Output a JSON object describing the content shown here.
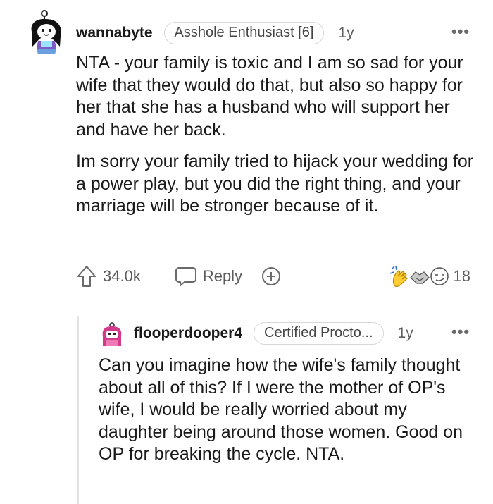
{
  "comment": {
    "username": "wannabyte",
    "flair": "Asshole Enthusiast [6]",
    "age": "1y",
    "paragraphs": [
      "NTA - your family is toxic and I am so sad for your wife that they would do that, but also so happy for her that she has a husband who will support her and have her back.",
      "Im sorry your family tried to hijack your wedding for a power play, but you did the right thing, and your marriage will be stronger because of it."
    ],
    "upvotes": "34.0k",
    "reply_label": "Reply",
    "award_count": "18"
  },
  "reply": {
    "username": "flooperdooper4",
    "flair": "Certified Procto...",
    "age": "1y",
    "text": "Can you imagine how the wife's family thought about all of this? If I were the mother of OP's wife, I would be really worried about my daughter being around those women. Good on OP for breaking the cycle. NTA."
  },
  "icons": {
    "more": "more-options-icon",
    "upvote": "upvote-arrow-icon",
    "reply": "speech-bubble-icon",
    "add_award": "add-award-icon",
    "awards": [
      "clapping-hands-award-icon",
      "handshake-award-icon",
      "face-award-icon"
    ]
  },
  "colors": {
    "text": "#1a1a1b",
    "muted": "#5c5c5c",
    "flair_border": "#d7d7d7",
    "thread_line": "#e4e4e4"
  }
}
